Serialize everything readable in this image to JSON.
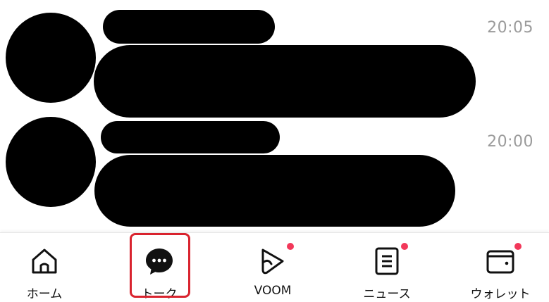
{
  "colors": {
    "highlight": "#d9232e",
    "notification_dot": "#f2385a",
    "time_text": "#9b9b9b"
  },
  "chat_list": [
    {
      "time": "20:05"
    },
    {
      "time": "20:00"
    }
  ],
  "tabbar": {
    "tabs": [
      {
        "label": "ホーム",
        "icon": "home-icon",
        "badge": false
      },
      {
        "label": "トーク",
        "icon": "chat-bubble-icon",
        "badge": false,
        "selected": true
      },
      {
        "label": "VOOM",
        "icon": "play-icon",
        "badge": true
      },
      {
        "label": "ニュース",
        "icon": "news-icon",
        "badge": true
      },
      {
        "label": "ウォレット",
        "icon": "wallet-icon",
        "badge": true
      }
    ]
  }
}
